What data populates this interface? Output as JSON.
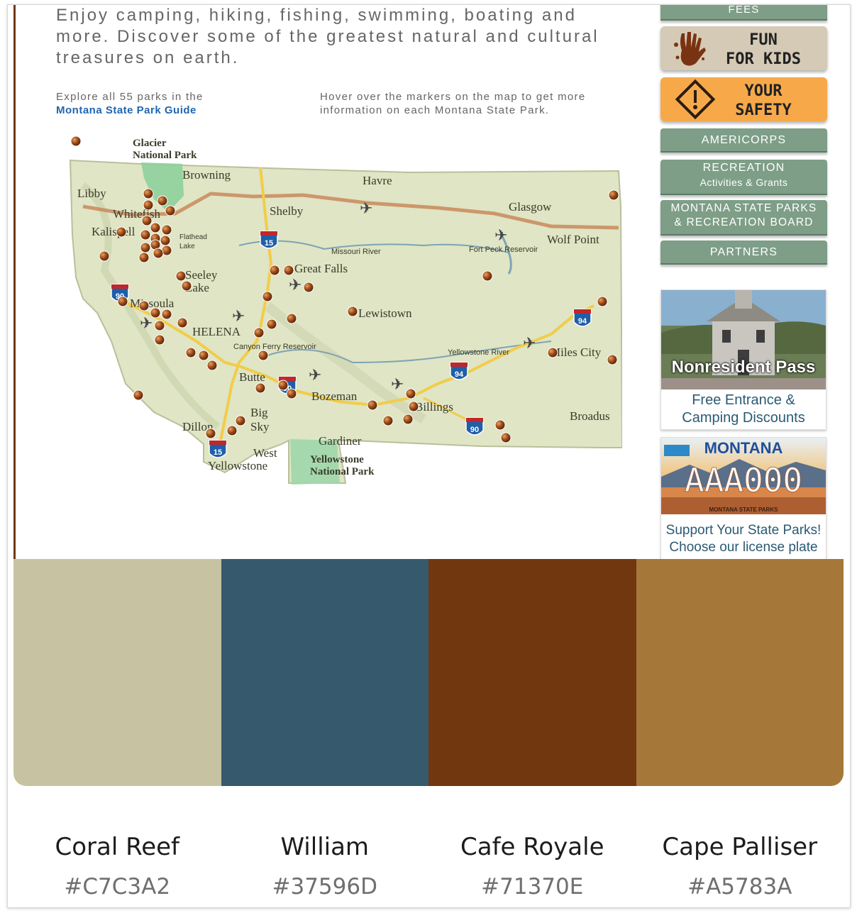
{
  "page": {
    "intro_text": "Enjoy camping, hiking, fishing, swimming, boating and more. Discover some of the greatest natural and cultural treasures on earth.",
    "explore_text": "Explore all 55 parks in the",
    "guide_link": "Montana State Park Guide",
    "hover_text": "Hover over the markers on the map to get more information on each Montana State Park."
  },
  "sidebar": {
    "fees": "FEES",
    "fun_for_kids": {
      "line1": "FUN",
      "line2": "FOR KIDS"
    },
    "your_safety": {
      "line1": "YOUR",
      "line2": "SAFETY"
    },
    "americorps": "AMERICORPS",
    "recreation": {
      "line1": "RECREATION",
      "line2": "Activities & Grants"
    },
    "board": {
      "line1": "MONTANA STATE PARKS",
      "line2": "& RECREATION BOARD"
    },
    "partners": "PARTNERS",
    "ad_pass": {
      "title": "Nonresident Pass",
      "line1": "Free Entrance &",
      "line2": "Camping Discounts"
    },
    "ad_plate": {
      "state": "MONTANA",
      "plate": "AAA000",
      "caption": "MONTANA STATE PARKS",
      "line1": "Support Your State Parks!",
      "line2": "Choose our license plate"
    }
  },
  "map": {
    "labels": {
      "glacier": "Glacier",
      "glacier2": "National Park",
      "browning": "Browning",
      "havre": "Havre",
      "libby": "Libby",
      "whitefish": "Whitefish",
      "kalispell": "Kalispell",
      "shelby": "Shelby",
      "glasgow": "Glasgow",
      "wolfpoint": "Wolf Point",
      "flathead": "Flathead",
      "lake": "Lake",
      "missouri": "Missouri River",
      "fortpeck": "Fort Peck Reservoir",
      "greatfalls": "Great Falls",
      "seeley": "Seeley",
      "seeley2": "Lake",
      "missoula": "Missoula",
      "lewistown": "Lewistown",
      "helena": "HELENA",
      "canyonferry": "Canyon Ferry Reservoir",
      "yellowstoneriver": "Yellowstone River",
      "milescity": "Miles City",
      "butte": "Butte",
      "bozeman": "Bozeman",
      "billings": "Billings",
      "broadus": "Broadus",
      "bigsky": "Big",
      "bigsky2": "Sky",
      "dillon": "Dillon",
      "gardiner": "Gardiner",
      "westyellowstone": "West",
      "westyellowstone2": "Yellowstone",
      "ynp": "Yellowstone",
      "ynp2": "National Park",
      "i15": "15",
      "i90": "90",
      "i94": "94"
    }
  },
  "palette": [
    {
      "name": "Coral Reef",
      "hex": "#C7C3A2"
    },
    {
      "name": "William",
      "hex": "#37596D"
    },
    {
      "name": "Cafe Royale",
      "hex": "#71370E"
    },
    {
      "name": "Cape Palliser",
      "hex": "#A5783A"
    }
  ]
}
